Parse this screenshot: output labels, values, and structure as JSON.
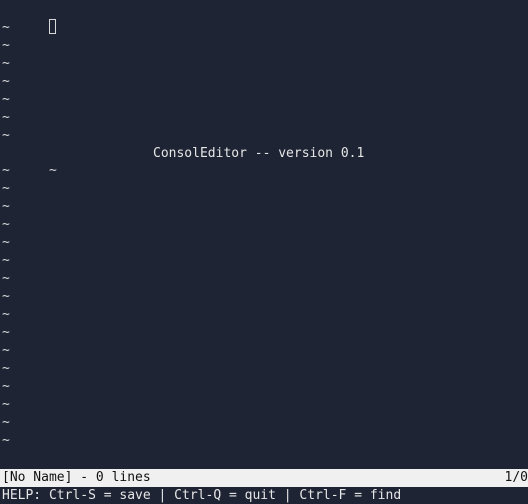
{
  "editor": {
    "tilde": "~",
    "welcome_message": "ConsolEditor -- version 0.1"
  },
  "status_bar": {
    "filename_info": "[No Name] - 0 lines",
    "position": "1/0"
  },
  "help_bar": {
    "text": "HELP: Ctrl-S = save | Ctrl-Q = quit | Ctrl-F = find"
  },
  "colors": {
    "background": "#1e2434",
    "text": "#e6e6e6",
    "status_bar_bg": "#f0f0f0",
    "status_bar_fg": "#111111"
  }
}
